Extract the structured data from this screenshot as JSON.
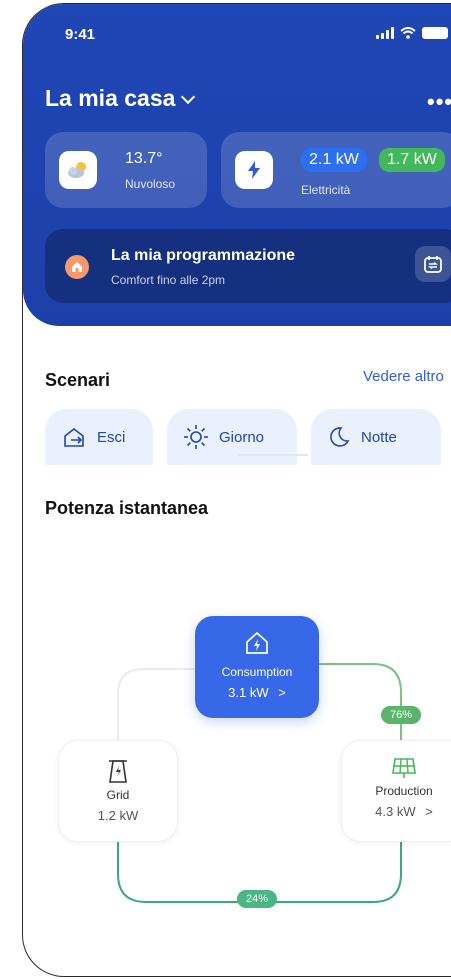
{
  "status": {
    "time": "9:41"
  },
  "header": {
    "title": "La mia casa",
    "more_label": "•••"
  },
  "weather": {
    "temperature": "13.7°",
    "condition": "Nuvoloso"
  },
  "electricity": {
    "consumption": "2.1 kW",
    "production": "1.7 kW",
    "label": "Elettricità"
  },
  "schedule": {
    "title": "La mia programmazione",
    "subtitle": "Comfort fino alle 2pm"
  },
  "scenari": {
    "title": "Scenari",
    "see_more": "Vedere altro",
    "items": [
      {
        "label": "Esci",
        "icon": "exit-icon"
      },
      {
        "label": "Giorno",
        "icon": "sun-icon"
      },
      {
        "label": "Notte",
        "icon": "moon-icon"
      }
    ]
  },
  "power": {
    "title": "Potenza istantanea",
    "consumption": {
      "label": "Consumption",
      "value": "3.1 kW",
      "arrow": ">"
    },
    "grid": {
      "label": "Grid",
      "value": "1.2 kW"
    },
    "production": {
      "label": "Production",
      "value": "4.3 kW",
      "arrow": ">"
    },
    "production_share": "76%",
    "grid_share": "24%"
  },
  "colors": {
    "primary": "#1f47b5",
    "accent": "#3668e8",
    "green": "#43b85a"
  }
}
